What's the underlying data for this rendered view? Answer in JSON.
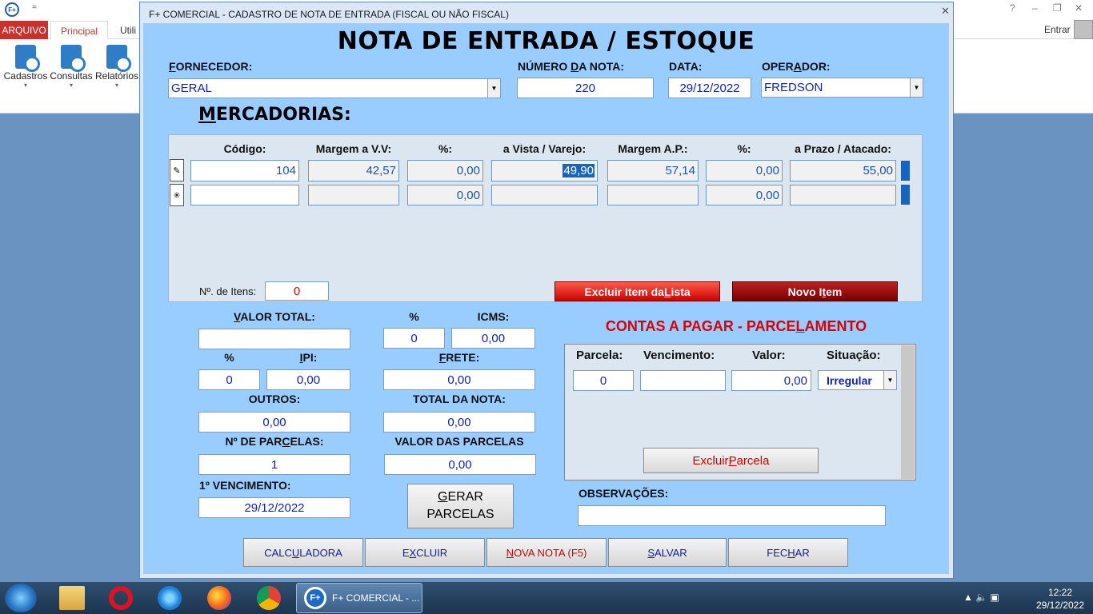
{
  "backapp": {
    "qat": "=",
    "tabs": {
      "arquivo": "ARQUIVO",
      "principal": "Principal",
      "util": "Utili"
    },
    "entrar": "Entrar",
    "help": "?",
    "min": "–",
    "max": "❐",
    "close": "✕",
    "ribbon": [
      {
        "label": "Cadastros"
      },
      {
        "label": "Consultas"
      },
      {
        "label": "Relatórios"
      }
    ],
    "caret": "▾"
  },
  "dialog": {
    "title": "F+ COMERCIAL - CADASTRO DE NOTA DE ENTRADA (FISCAL OU NÃO FISCAL)",
    "close": "✕",
    "heading": "NOTA DE ENTRADA / ESTOQUE",
    "labels": {
      "fornecedor_a": "F",
      "fornecedor_b": "ORNECEDOR:",
      "numero_a": "NÚMERO ",
      "numero_b": "D",
      "numero_c": "A NOTA:",
      "data": "DATA:",
      "operador_a": "OPER",
      "operador_b": "A",
      "operador_c": "DOR:"
    },
    "fornecedor": "GERAL",
    "numero": "220",
    "data": "29/12/2022",
    "operador": "FREDSON",
    "dropdown_arrow": "▼",
    "mercadorias_a": "M",
    "mercadorias_b": "ERCADORIAS:",
    "grid": {
      "headers": [
        "Código:",
        "Margem a V.V:",
        "%:",
        "a Vista / Varejo:",
        "Margem A.P.:",
        "%:",
        "a Prazo / Atacado:"
      ],
      "row1": {
        "selector": "✎",
        "codigo": "104",
        "margem_vv": "42,57",
        "pct1": "0,00",
        "vista": "49,90",
        "margem_ap": "57,14",
        "pct2": "0,00",
        "prazo": "55,00"
      },
      "row2": {
        "selector": "✳",
        "pct1": "0,00",
        "pct2": "0,00"
      }
    },
    "n_itens_label": "Nº. de Itens:",
    "n_itens": "0",
    "excluir_item_a": "Excluir Item da ",
    "excluir_item_b": "L",
    "excluir_item_c": "ista",
    "novo_item_a": "Novo I",
    "novo_item_b": "t",
    "novo_item_c": "em",
    "valor_total_a": "V",
    "valor_total_b": "ALOR TOTAL:",
    "valor_total": "",
    "pct_label": "%",
    "icms_label": "ICMS:",
    "icms_pct": "0",
    "icms": "0,00",
    "ipi_pct_label": "%",
    "ipi_label_a": "I",
    "ipi_label_b": "PI:",
    "ipi_pct": "0",
    "ipi": "0,00",
    "frete_label_a": "F",
    "frete_label_b": "RETE:",
    "frete": "0,00",
    "outros_label": "OUTROS:",
    "outros": "0,00",
    "total_nota_label": "TOTAL DA NOTA:",
    "total_nota": "0,00",
    "n_parcelas_label_a": "Nº DE PAR",
    "n_parcelas_label_b": "C",
    "n_parcelas_label_c": "ELAS:",
    "n_parcelas": "1",
    "valor_parcelas_label": "VALOR DAS PARCELAS",
    "valor_parcelas": "0,00",
    "primeiro_venc_label": "1º VENCIMENTO:",
    "primeiro_venc": "29/12/2022",
    "gerar_a": "G",
    "gerar_b": "ERAR",
    "gerar_c": "PARCELAS",
    "contas_title_a": "CONTAS A PAGAR - PARCE",
    "contas_title_b": "L",
    "contas_title_c": "AMENTO",
    "contas_headers": [
      "Parcela:",
      "Vencimento:",
      "Valor:",
      "Situação:"
    ],
    "parcela": "0",
    "vencimento": "",
    "valor": "0,00",
    "situacao": "Irregular",
    "excluir_parcela_a": "Excluir ",
    "excluir_parcela_b": "P",
    "excluir_parcela_c": "arcela",
    "observacoes_label": "OBSERVAÇÕES:",
    "observacoes": "",
    "buttons": {
      "calc_a": "CALC",
      "calc_b": "U",
      "calc_c": "LADORA",
      "excluir_a": "E",
      "excluir_b": "X",
      "excluir_c": "CLUIR",
      "nova_a": "N",
      "nova_b": "OVA NOTA (F5)",
      "salvar_a": "S",
      "salvar_b": "ALVAR",
      "fechar_a": "FEC",
      "fechar_b": "H",
      "fechar_c": "AR"
    }
  },
  "taskbar": {
    "app_label": "F+ COMERCIAL - ...",
    "app_icon": "F+",
    "tray": "▲  🔈  ▣",
    "time": "12:22",
    "date": "29/12/2022"
  },
  "colors": {
    "panel": "#99ccff",
    "accent_red": "#e00000",
    "text_blue": "#1020c0"
  }
}
